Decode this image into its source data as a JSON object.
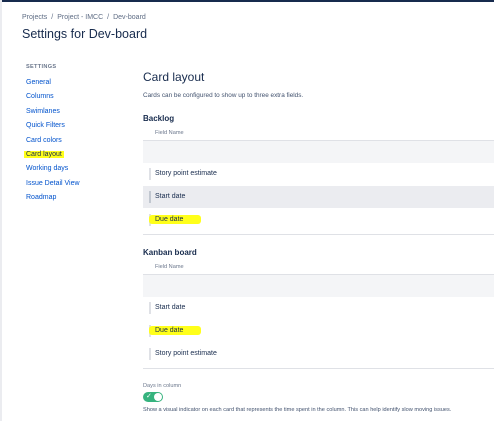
{
  "breadcrumb": [
    "Projects",
    "Project - IMCC",
    "Dev-board"
  ],
  "breadcrumb_separator": "/",
  "page_title": "Settings for Dev-board",
  "sidebar": {
    "heading": "SETTINGS",
    "items": [
      {
        "label": "General"
      },
      {
        "label": "Columns"
      },
      {
        "label": "Swimlanes"
      },
      {
        "label": "Quick Filters"
      },
      {
        "label": "Card colors"
      },
      {
        "label": "Card layout",
        "selected": true
      },
      {
        "label": "Working days"
      },
      {
        "label": "Issue Detail View"
      },
      {
        "label": "Roadmap"
      }
    ]
  },
  "card_layout": {
    "title": "Card layout",
    "description": "Cards can be configured to show up to three extra fields.",
    "backlog": {
      "title": "Backlog",
      "column_header": "Field Name",
      "fields": [
        "Story point estimate",
        "Start date",
        "Due date"
      ]
    },
    "kanban": {
      "title": "Kanban board",
      "column_header": "Field Name",
      "fields": [
        "Start date",
        "Due date",
        "Story point estimate"
      ]
    }
  },
  "days_in_column": {
    "label": "Days in column",
    "enabled": true,
    "description": "Show a visual indicator on each card that represents the time spent in the column. This can help identify slow moving issues."
  },
  "colors": {
    "link": "#0052cc",
    "highlight": "#ffff1a",
    "toggle_on": "#36b37e",
    "text": "#172b4d"
  }
}
